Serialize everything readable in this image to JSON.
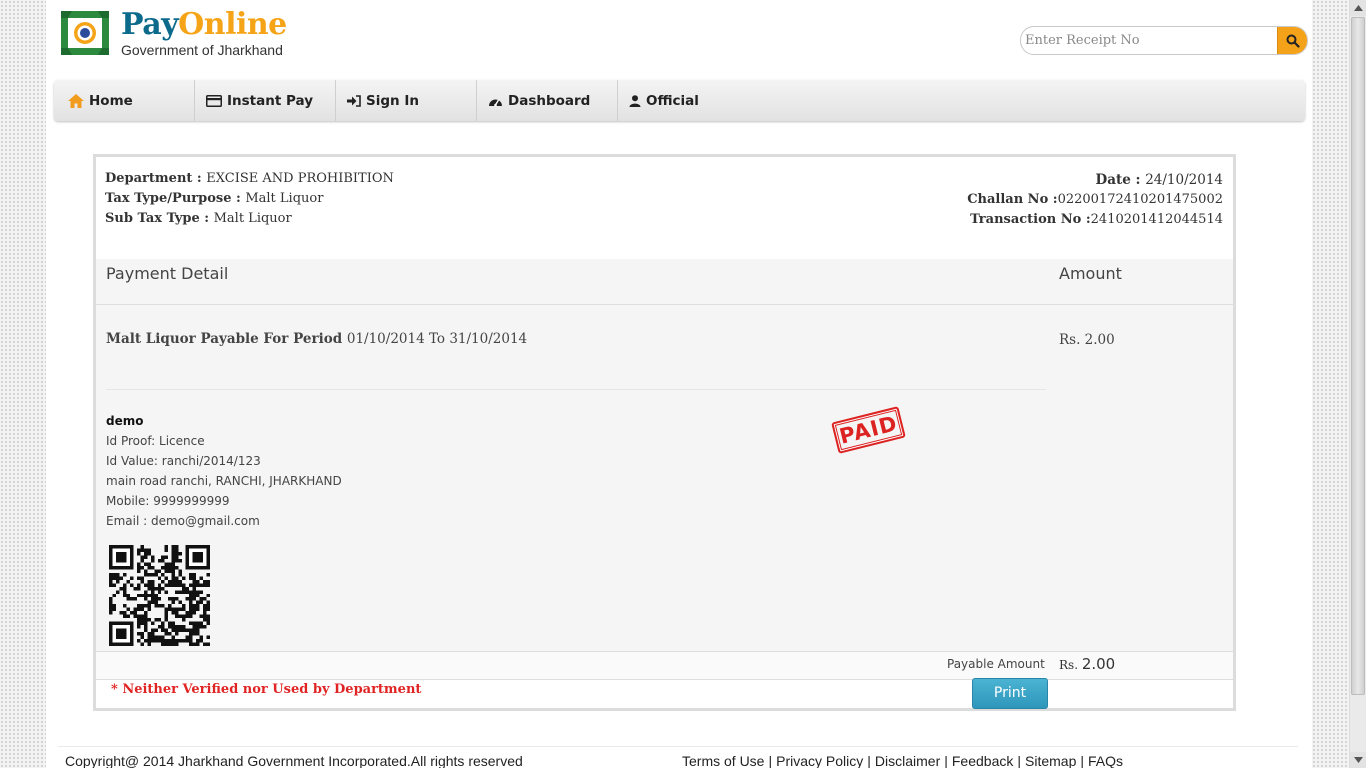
{
  "header": {
    "brand_pay": "Pay",
    "brand_online": "Online",
    "brand_sub": "Government of Jharkhand",
    "search_placeholder": "Enter Receipt No",
    "search_icon": "search-icon"
  },
  "nav": {
    "items": [
      {
        "label": "Home",
        "icon": "home-icon"
      },
      {
        "label": "Instant Pay",
        "icon": "credit-card-icon"
      },
      {
        "label": "Sign In",
        "icon": "sign-in-icon"
      },
      {
        "label": "Dashboard",
        "icon": "dashboard-icon"
      },
      {
        "label": "Official",
        "icon": "user-icon"
      }
    ]
  },
  "receipt": {
    "department_label": "Department : ",
    "department_value": "EXCISE AND PROHIBITION",
    "tax_type_label": "Tax Type/Purpose : ",
    "tax_type_value": "Malt Liquor",
    "sub_tax_label": "Sub Tax Type : ",
    "sub_tax_value": "Malt Liquor",
    "date_label": "Date : ",
    "date_value": "24/10/2014",
    "challan_label": "Challan No :",
    "challan_value": "02200172410201475002",
    "transaction_label": "Transaction No :",
    "transaction_value": "2410201412044514",
    "payment_detail_heading": "Payment Detail",
    "amount_heading": "Amount",
    "line_item_bold": "Malt Liquor Payable For Period ",
    "line_item_period": "01/10/2014 To 31/10/2014",
    "line_item_amount": "Rs. 2.00",
    "payer": {
      "name": "demo",
      "id_proof": "Id Proof: Licence",
      "id_value": "Id Value: ranchi/2014/123",
      "address": "main road ranchi, RANCHI, JHARKHAND",
      "mobile": "Mobile: 9999999999",
      "email": "Email : demo@gmail.com"
    },
    "stamp": "PAID",
    "payable_label": "Payable Amount",
    "payable_rs": "Rs. ",
    "payable_value": "2.00",
    "note": "* Neither Verified nor Used by Department",
    "print_label": "Print",
    "accent_color": "#e02424"
  },
  "footer": {
    "copyright": "Copyright@ 2014 Jharkhand Government Incorporated.All rights reserved",
    "links": [
      "Terms of Use",
      "Privacy Policy",
      "Disclaimer",
      "Feedback",
      "Sitemap",
      "FAQs"
    ]
  }
}
